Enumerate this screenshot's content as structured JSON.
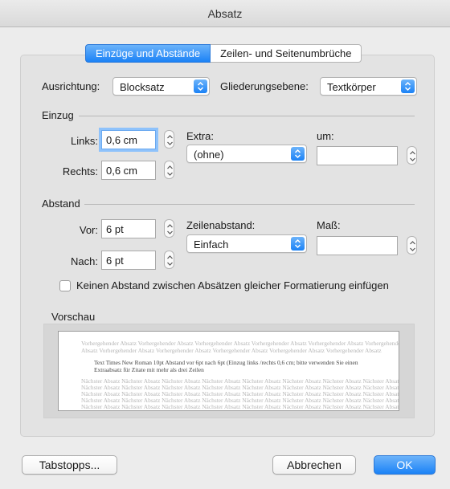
{
  "window": {
    "title": "Absatz"
  },
  "tabs": [
    {
      "label": "Einzüge und Abstände",
      "active": true
    },
    {
      "label": "Zeilen- und Seitenumbrüche",
      "active": false
    }
  ],
  "alignment": {
    "label": "Ausrichtung:",
    "value": "Blocksatz"
  },
  "outline": {
    "label": "Gliederungsebene:",
    "value": "Textkörper"
  },
  "indent": {
    "section": "Einzug",
    "left_label": "Links:",
    "left_value": "0,6 cm",
    "right_label": "Rechts:",
    "right_value": "0,6 cm",
    "extra_label": "Extra:",
    "extra_value": "(ohne)",
    "by_label": "um:",
    "by_value": ""
  },
  "spacing": {
    "section": "Abstand",
    "before_label": "Vor:",
    "before_value": "6 pt",
    "after_label": "Nach:",
    "after_value": "6 pt",
    "line_label": "Zeilenabstand:",
    "line_value": "Einfach",
    "measure_label": "Maß:",
    "measure_value": ""
  },
  "no_space_checkbox": {
    "label": "Keinen Abstand zwischen Absätzen gleicher Formatierung einfügen",
    "checked": false
  },
  "preview": {
    "label": "Vorschau",
    "prev_lines": [
      "Vorhergehender Absatz Vorhergehender Absatz Vorhergehender Absatz Vorhergehender Absatz Vorhergehender Absatz Vorhergehender Absatz",
      "Absatz Vorhergehender Absatz Vorhergehender Absatz Vorhergehender Absatz Vorhergehender Absatz Vorhergehender Absatz"
    ],
    "main_lines": [
      "Text Times New Roman 10pt Abstand vor 6pt nach 6pt (Einzug links /rechts 0,6 cm; bitte verwenden Sie einen",
      "Extraabsatz für Zitate mit mehr als drei Zeilen"
    ],
    "next_lines": [
      "Nächster Absatz Nächster Absatz Nächster Absatz Nächster Absatz Nächster Absatz Nächster Absatz Nächster Absatz Nächster Absatz",
      "Nächster Absatz Nächster Absatz Nächster Absatz Nächster Absatz Nächster Absatz Nächster Absatz Nächster Absatz Nächster Absatz",
      "Nächster Absatz Nächster Absatz Nächster Absatz Nächster Absatz Nächster Absatz Nächster Absatz Nächster Absatz Nächster Absatz",
      "Nächster Absatz Nächster Absatz Nächster Absatz Nächster Absatz Nächster Absatz Nächster Absatz Nächster Absatz Nächster Absatz",
      "Nächster Absatz Nächster Absatz Nächster Absatz Nächster Absatz Nächster Absatz Nächster Absatz Nächster Absatz Nächster Absatz"
    ]
  },
  "buttons": {
    "tabstops": "Tabstopps...",
    "cancel": "Abbrechen",
    "ok": "OK"
  },
  "colors": {
    "accent": "#1b82f6",
    "dialog_bg": "#ececec"
  }
}
